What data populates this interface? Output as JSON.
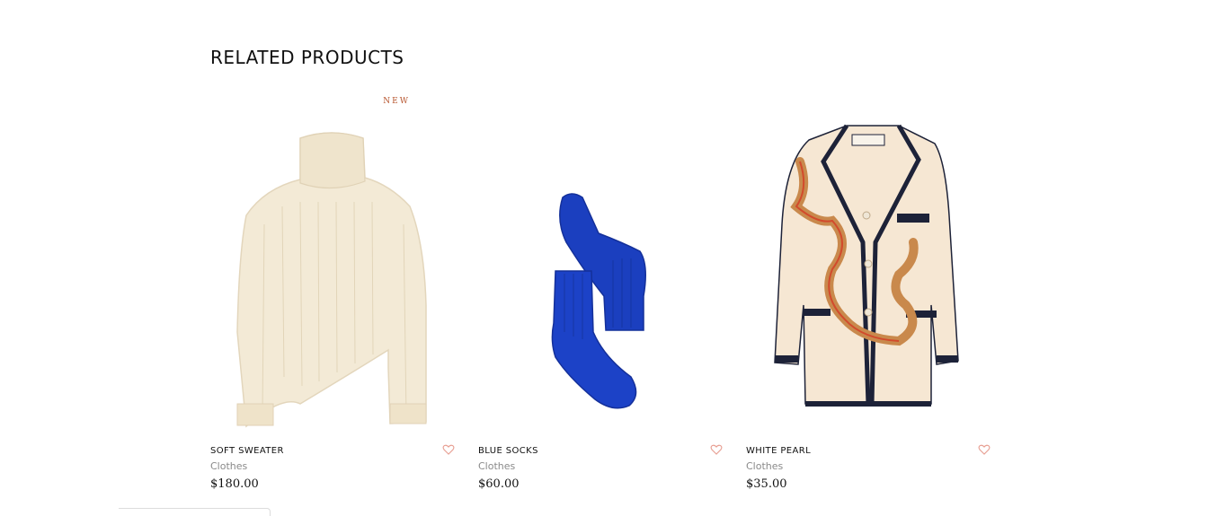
{
  "section": {
    "title": "RELATED PRODUCTS"
  },
  "products": [
    {
      "name": "SOFT SWEATER",
      "category": "Clothes",
      "price": "$180.00",
      "badge": "NEW",
      "image_icon": "sweater-image"
    },
    {
      "name": "BLUE SOCKS",
      "category": "Clothes",
      "price": "$60.00",
      "badge": "",
      "image_icon": "socks-image"
    },
    {
      "name": "WHITE PEARL",
      "category": "Clothes",
      "price": "$35.00",
      "badge": "",
      "image_icon": "blazer-image"
    }
  ],
  "colors": {
    "accent": "#b7552e",
    "heart": "#e8a195",
    "sweater": "#f3ead6",
    "socks": "#1b3fbf",
    "blazer": "#f6e7d3",
    "blazer_trim": "#1d2238"
  }
}
